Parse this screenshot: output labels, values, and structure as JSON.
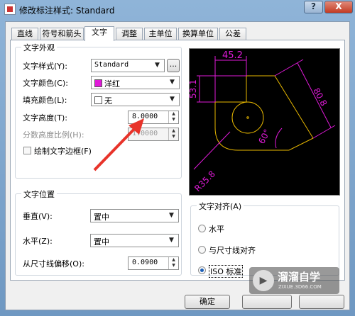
{
  "window": {
    "title": "修改标注样式: Standard",
    "help_label": "?",
    "close_label": "X"
  },
  "tabs": [
    {
      "label": "直线"
    },
    {
      "label": "符号和箭头"
    },
    {
      "label": "文字"
    },
    {
      "label": "调整"
    },
    {
      "label": "主单位"
    },
    {
      "label": "换算单位"
    },
    {
      "label": "公差"
    }
  ],
  "active_tab": "文字",
  "appearance": {
    "title": "文字外观",
    "style_label": "文字样式(Y):",
    "style_value": "Standard",
    "style_browse": "...",
    "color_label": "文字颜色(C):",
    "color_value": "洋红",
    "color_swatch": "#e01ad8",
    "fill_label": "填充颜色(L):",
    "fill_value": "无",
    "height_label": "文字高度(T):",
    "height_value": "8.0000",
    "fraction_label": "分数高度比例(H):",
    "fraction_value": "1.0000",
    "frame_label": "绘制文字边框(F)"
  },
  "placement": {
    "title": "文字位置",
    "vertical_label": "垂直(V):",
    "vertical_value": "置中",
    "horizontal_label": "水平(Z):",
    "horizontal_value": "置中",
    "offset_label": "从尺寸线偏移(O):",
    "offset_value": "0.0900"
  },
  "alignment": {
    "title": "文字对齐(A)",
    "options": [
      "水平",
      "与尺寸线对齐",
      "ISO 标准"
    ],
    "selected": "ISO 标准"
  },
  "preview": {
    "dim_top": "45.2",
    "dim_left": "53.1",
    "dim_right": "80.8",
    "dim_angle": "60°",
    "dim_radius": "R35.8",
    "geometry_color": "#e8b800",
    "dimension_color": "#e01ad8"
  },
  "footer": {
    "ok_label": "确定"
  },
  "watermark": {
    "title": "溜溜自学",
    "url": "ZIXUE.3D66.COM"
  },
  "colors": {
    "annotation_arrow": "#e8332a"
  }
}
